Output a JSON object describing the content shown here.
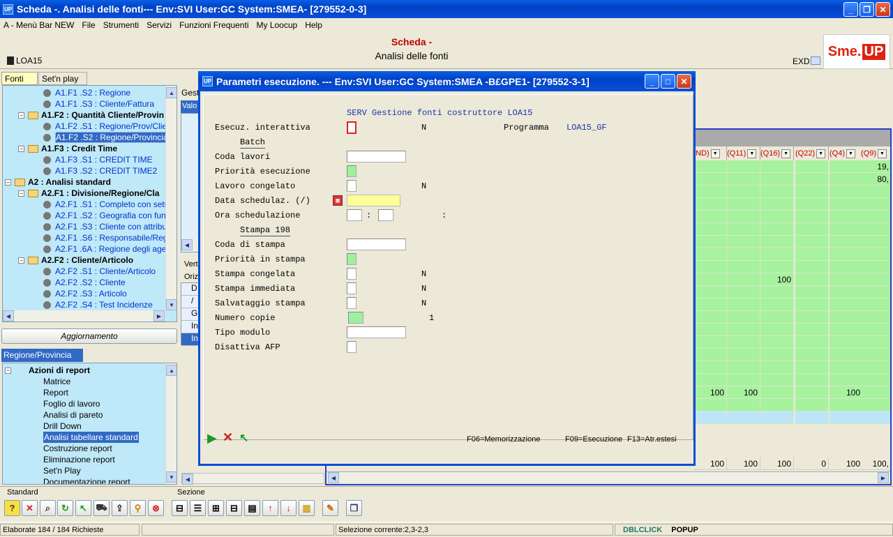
{
  "window": {
    "title": "Scheda -. Analisi delle fonti--- Env:SVI User:GC System:SMEA- [279552-0-3]",
    "app_icon_text": "UP"
  },
  "menu": [
    "A - Menù Bar NEW",
    "File",
    "Strumenti",
    "Servizi",
    "Funzioni Frequenti",
    "My Loocup",
    "Help"
  ],
  "header": {
    "line1": "Scheda -",
    "line2": "Analisi delle fonti",
    "code": "LOA15",
    "exd": "EXD",
    "logo_a": "Sme.",
    "logo_b": "UP"
  },
  "left_tabs": [
    "Fonti",
    "Set'n play"
  ],
  "tree1": [
    {
      "label": "A1.F1 .S2 : Regione",
      "type": "leaf"
    },
    {
      "label": "A1.F1 .S3 : Cliente/Fattura",
      "type": "leaf"
    },
    {
      "label": "A1.F2 : Quantità Cliente/Provin",
      "type": "folder"
    },
    {
      "label": "A1.F2 .S1 : Regione/Prov/Client",
      "type": "leaf"
    },
    {
      "label": "A1.F2 .S2 : Regione/Provincia",
      "type": "leaf",
      "selected": true
    },
    {
      "label": "A1.F3 : Credit Time",
      "type": "folder"
    },
    {
      "label": "A1.F3 .S1 : CREDIT TIME",
      "type": "leaf"
    },
    {
      "label": "A1.F3 .S2 : CREDIT TIME2",
      "type": "leaf"
    },
    {
      "label": "A2 : Analisi standard",
      "type": "root"
    },
    {
      "label": "A2.F1 : Divisione/Regione/Cla",
      "type": "folder"
    },
    {
      "label": "A2.F1 .S1 : Completo con setup",
      "type": "leaf"
    },
    {
      "label": "A2.F1 .S2 : Geografia con funzio",
      "type": "leaf"
    },
    {
      "label": "A2.F1 .S3 : Cliente con attributi",
      "type": "leaf"
    },
    {
      "label": "A2.F1 .S6 : Responsabile/Regio",
      "type": "leaf"
    },
    {
      "label": "A2.F1 .6A : Regione degli agenti",
      "type": "leaf"
    },
    {
      "label": "A2.F2 : Cliente/Articolo",
      "type": "folder"
    },
    {
      "label": "A2.F2 .S1 : Cliente/Articolo",
      "type": "leaf"
    },
    {
      "label": "A2.F2 .S2 : Cliente",
      "type": "leaf"
    },
    {
      "label": "A2.F2 .S3 : Articolo",
      "type": "leaf"
    },
    {
      "label": "A2.F2 .S4 : Test Incidenze",
      "type": "leaf"
    }
  ],
  "update_button": "Aggiornamento",
  "report_tab": "Regione/Provincia",
  "tree2": {
    "root": "Azioni di report",
    "items": [
      "Matrice",
      "Report",
      "Foglio di lavoro",
      "Analisi di pareto",
      "Drill Down",
      "Analisi tabellare standard",
      "Costruzione report",
      "Eliminazione report",
      "Set'n Play",
      "Documentazione report"
    ],
    "selected_index": 5
  },
  "middle": {
    "tab1": "Gest",
    "tab2": "Valo",
    "label_ver": "Verti",
    "label_ori": "Orizz",
    "rows": [
      "D",
      "/",
      "G",
      "In",
      "In"
    ]
  },
  "grid": {
    "columns": [
      "IND)",
      "(Q11)",
      "(Q16)",
      "(Q22)",
      "(Q4)",
      "(Q9)"
    ],
    "cells": [
      {
        "row": 0,
        "col": 5,
        "value": "19,"
      },
      {
        "row": 1,
        "col": 5,
        "value": "80,"
      },
      {
        "row": 9,
        "col": 2,
        "value": "100"
      },
      {
        "row": 18,
        "col": 0,
        "value": "100"
      },
      {
        "row": 18,
        "col": 1,
        "value": "100"
      },
      {
        "row": 18,
        "col": 4,
        "value": "100"
      }
    ],
    "totals": [
      "100",
      "100",
      "100",
      "0",
      "100",
      "100,"
    ]
  },
  "dialog": {
    "title": "Parametri esecuzione. --- Env:SVI User:GC System:SMEA -B£GPE1- [279552-3-1]",
    "heading": "SERV Gestione fonti costruttore LOA15",
    "programma_label": "Programma",
    "programma_value": "LOA15_GF",
    "fields": [
      {
        "label": "Esecuz. interattiva",
        "value": "N"
      },
      {
        "label": "Coda lavori",
        "value": ""
      },
      {
        "label": "Priorità esecuzione",
        "value": ""
      },
      {
        "label": "Lavoro congelato",
        "value": "N"
      },
      {
        "label": "Data schedulaz. (/)",
        "value": ""
      },
      {
        "label": "Ora  schedulazione",
        "value": ":"
      },
      {
        "label": "Coda di stampa",
        "value": ""
      },
      {
        "label": "Priorità in stampa",
        "value": ""
      },
      {
        "label": "Stampa congelata",
        "value": "N"
      },
      {
        "label": "Stampa immediata",
        "value": "N"
      },
      {
        "label": "Salvataggio stampa",
        "value": "N"
      },
      {
        "label": "Numero copie",
        "value": "1"
      },
      {
        "label": "Tipo modulo",
        "value": ""
      },
      {
        "label": "Disattiva AFP",
        "value": ""
      }
    ],
    "section_batch": "Batch",
    "section_stampa": "Stampa 198",
    "time_sep": ":",
    "fkeys": [
      "F06=Memorizzazione",
      "F09=Esecuzione",
      "F13=Atr.estesi"
    ]
  },
  "toolbar": {
    "label_standard": "Standard",
    "label_sezione": "Sezione"
  },
  "status": {
    "left": "Elaborate 184 / 184 Richieste",
    "middle": "Selezione corrente:2,3-2,3",
    "dblclick": "DBLCLICK",
    "popup": "POPUP"
  },
  "colors": {
    "title_blue": "#0a4ed8",
    "tree_bg": "#bfe8f8",
    "grid_green": "#a6f29e",
    "accent_red": "#c00000"
  }
}
